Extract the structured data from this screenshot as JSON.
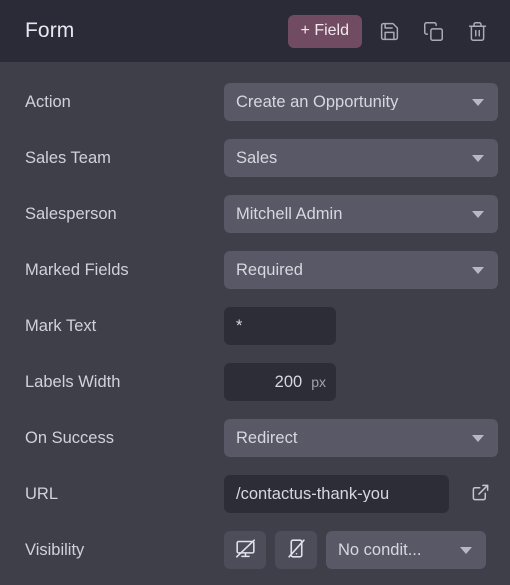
{
  "header": {
    "title": "Form",
    "add_field_label": "+ Field",
    "accent_color": "#714b61",
    "background": "#2b2b38",
    "actions": [
      {
        "name": "save-icon",
        "tooltip": "Save"
      },
      {
        "name": "duplicate-icon",
        "tooltip": "Duplicate"
      },
      {
        "name": "delete-icon",
        "tooltip": "Delete"
      }
    ]
  },
  "theme": {
    "body_background": "#3f3f4a",
    "select_background": "#585866",
    "input_background": "#2d2d38",
    "label_color": "#cfd2da",
    "value_color": "#d5d8df"
  },
  "rows": {
    "action": {
      "label": "Action",
      "value": "Create an Opportunity"
    },
    "sales_team": {
      "label": "Sales Team",
      "value": "Sales"
    },
    "salesperson": {
      "label": "Salesperson",
      "value": "Mitchell Admin"
    },
    "marked_fields": {
      "label": "Marked Fields",
      "value": "Required"
    },
    "mark_text": {
      "label": "Mark Text",
      "value": "*",
      "placeholder": ""
    },
    "labels_width": {
      "label": "Labels Width",
      "value": "200",
      "unit": "px",
      "placeholder": ""
    },
    "on_success": {
      "label": "On Success",
      "value": "Redirect"
    },
    "url": {
      "label": "URL",
      "value": "/contactus-thank-you",
      "placeholder": ""
    },
    "visibility": {
      "label": "Visibility",
      "value": "No condit...",
      "toggles": [
        {
          "name": "hide-on-desktop-toggle",
          "tooltip": "Hide on Desktop"
        },
        {
          "name": "hide-on-mobile-toggle",
          "tooltip": "Hide on Mobile"
        }
      ]
    }
  }
}
